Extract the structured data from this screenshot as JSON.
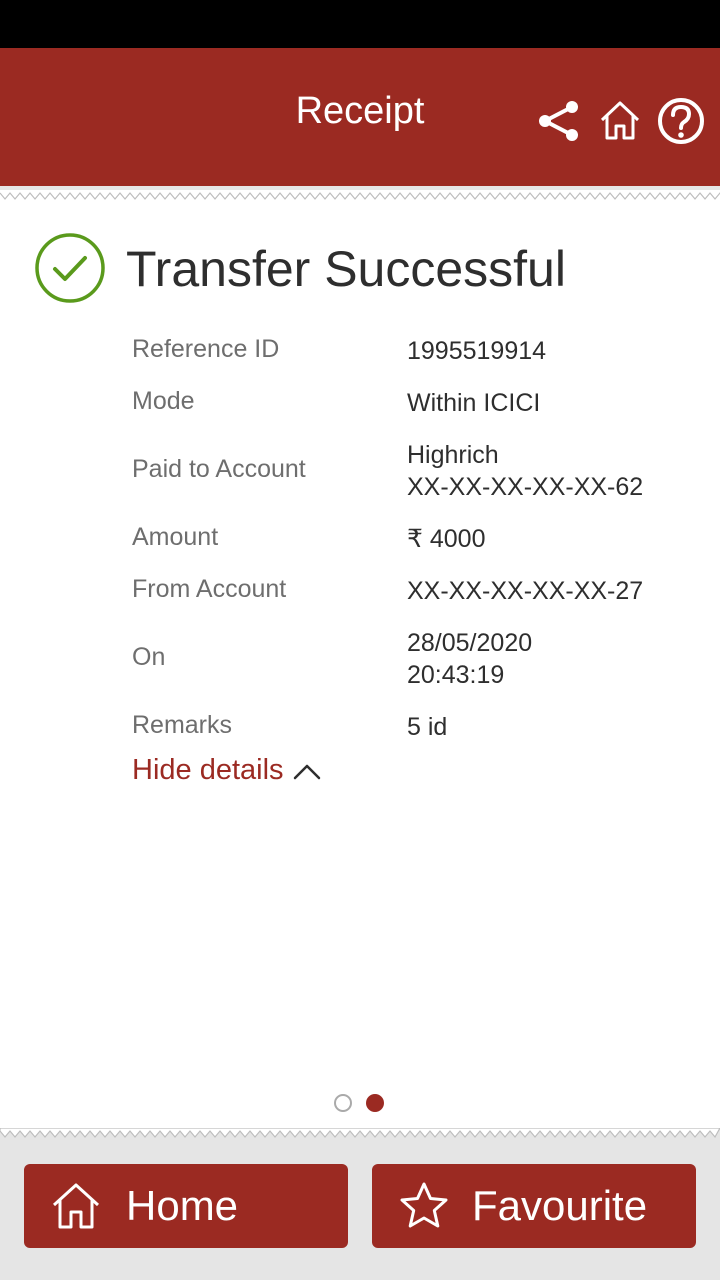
{
  "header": {
    "title": "Receipt",
    "icons": [
      "share-icon",
      "home-icon",
      "help-icon"
    ],
    "color": "#9b2a22"
  },
  "status": {
    "title": "Transfer Successful",
    "icon": "check-circle-icon",
    "color": "#5a9a1c"
  },
  "details": {
    "reference_label": "Reference ID",
    "reference_value": "1995519914",
    "mode_label": "Mode",
    "mode_value": "Within ICICI",
    "paid_to_label": "Paid to Account",
    "paid_to_name": "Highrich",
    "paid_to_account": "XX-XX-XX-XX-XX-62",
    "amount_label": "Amount",
    "amount_value": "₹ 4000",
    "from_label": "From Account",
    "from_value": "XX-XX-XX-XX-XX-27",
    "on_label": "On",
    "on_date": "28/05/2020",
    "on_time": "20:43:19",
    "remarks_label": "Remarks",
    "remarks_value": "5 id"
  },
  "toggle": {
    "label": "Hide details"
  },
  "pager": {
    "pages": 2,
    "active": 2
  },
  "footer": {
    "home_label": "Home",
    "favourite_label": "Favourite"
  }
}
